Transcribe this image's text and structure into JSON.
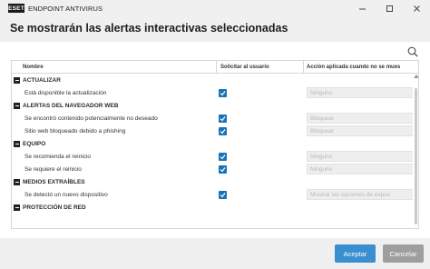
{
  "window": {
    "logo_text": "ESET",
    "app_title": "ENDPOINT ANTIVIRUS",
    "controls": {
      "minimize": "minimize-icon",
      "maximize": "maximize-icon",
      "close": "close-icon"
    }
  },
  "dialog": {
    "title": "Se mostrarán las alertas interactivas seleccionadas"
  },
  "table": {
    "columns": [
      "Nombre",
      "Solicitar al usuario",
      "Acción aplicada cuando no se mues"
    ],
    "groups": [
      {
        "name": "ACTUALIZAR",
        "items": [
          {
            "label": "Está disponible la actualización",
            "ask_user": true,
            "action": "Ninguno"
          }
        ]
      },
      {
        "name": "ALERTAS DEL NAVEGADOR WEB",
        "items": [
          {
            "label": "Se encontró contenido potencialmente no deseado",
            "ask_user": true,
            "action": "Bloquear"
          },
          {
            "label": "Sitio web bloqueado debido a phishing",
            "ask_user": true,
            "action": "Bloquear"
          }
        ]
      },
      {
        "name": "EQUIPO",
        "items": [
          {
            "label": "Se recomienda el reinicio",
            "ask_user": true,
            "action": "Ninguno"
          },
          {
            "label": "Se requiere el reinicio",
            "ask_user": true,
            "action": "Ninguno"
          }
        ]
      },
      {
        "name": "MEDIOS EXTRAÍBLES",
        "items": [
          {
            "label": "Se detectó un nuevo dispositivo",
            "ask_user": true,
            "action": "Mostrar las opciones de expos"
          }
        ]
      },
      {
        "name": "PROTECCIÓN DE RED",
        "items": []
      }
    ]
  },
  "footer": {
    "accept_label": "Aceptar",
    "cancel_label": "Cancelar"
  },
  "colors": {
    "accent": "#3a8fd1",
    "checkbox": "#1a73b8",
    "cancel": "#9e9e9e"
  }
}
